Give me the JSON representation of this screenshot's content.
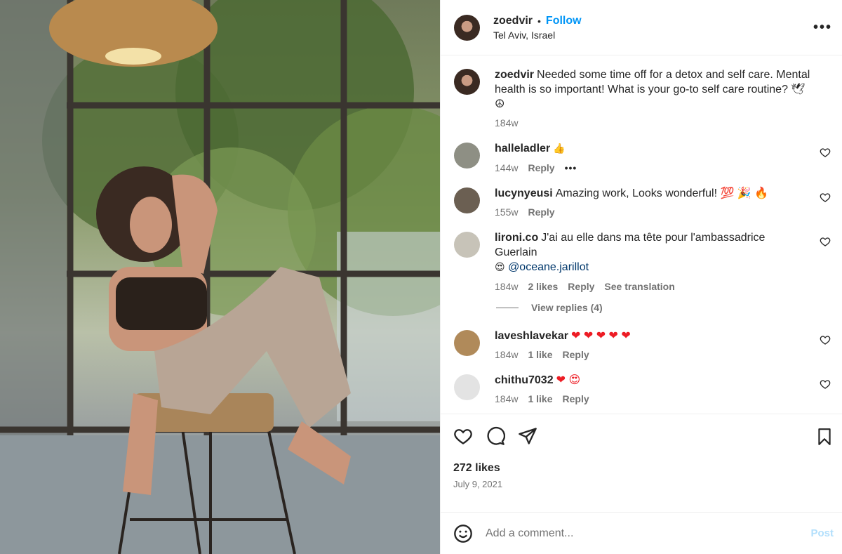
{
  "header": {
    "username": "zoedvir",
    "separator": "•",
    "follow_label": "Follow",
    "location": "Tel Aviv, Israel",
    "more_label": "•••"
  },
  "caption": {
    "username": "zoedvir",
    "text": "Needed some time off for a detox and self care. Mental health is so important! What is your go-to self care routine? 🕊 ☮",
    "age": "184w"
  },
  "comments": [
    {
      "username": "halleladler",
      "text": "👍",
      "age": "144w",
      "reply": "Reply",
      "more": "•••"
    },
    {
      "username": "lucynyeusi",
      "text": "Amazing work, Looks wonderful! 💯 🎉 🔥",
      "age": "155w",
      "reply": "Reply"
    },
    {
      "username": "lironi.co",
      "text": "J'ai au elle dans ma tête pour l'ambassadrice Guerlain",
      "emoji": "😍",
      "mention": "@oceane.jarillot",
      "age": "184w",
      "likes": "2 likes",
      "reply": "Reply",
      "translate": "See translation"
    },
    {
      "username": "laveshlavekar",
      "text": "❤ ❤ ❤ ❤ ❤",
      "age": "184w",
      "likes": "1 like",
      "reply": "Reply"
    },
    {
      "username": "chithu7032",
      "text": "❤ 😍",
      "age": "184w",
      "likes": "1 like",
      "reply": "Reply"
    }
  ],
  "view_replies": "View replies (4)",
  "footer": {
    "likes": "272 likes",
    "date": "July 9, 2021",
    "comment_placeholder": "Add a comment...",
    "post_label": "Post"
  },
  "colors": {
    "accent": "#0095f6",
    "heart_red": "#ed1c24"
  }
}
